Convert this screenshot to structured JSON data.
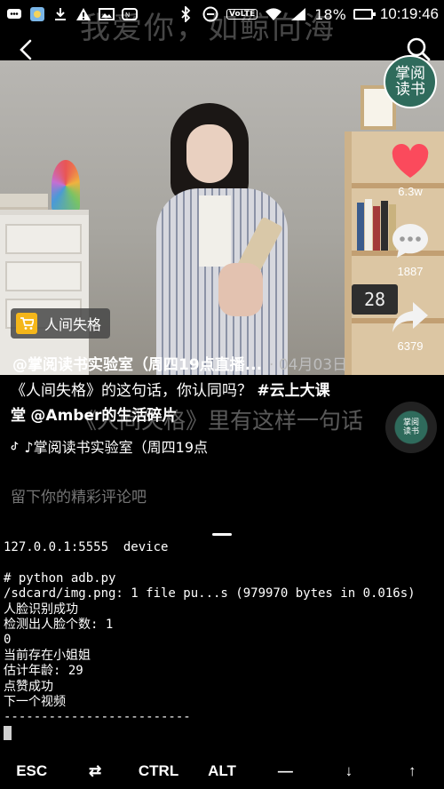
{
  "status_bar": {
    "battery": "18%",
    "time": "10:19:46",
    "volte": "VoLTE"
  },
  "lyric_top": "我爱你，如鲸向海",
  "video": {
    "calendar_text": "28"
  },
  "creator_badge": "掌阅读书",
  "actions": {
    "likes": "6.3w",
    "comments": "1887",
    "shares": "6379"
  },
  "tag_chip": "人间失格",
  "author": "@掌阅读书实验室（周四19点直播...",
  "date": "· 04月03日",
  "caption": {
    "text": "《人间失格》的这句话，你认同吗？",
    "hashtag": "#云上大课堂",
    "mention": "@Amber的生活碎片"
  },
  "lyric_mid": "《人间失格》里有这样一句话",
  "music": "♪掌阅读书实验室（周四19点",
  "music_disc": "掌阅读书",
  "comment_placeholder": "留下你的精彩评论吧",
  "terminal_lines": [
    "127.0.0.1:5555  device",
    "",
    "# python adb.py",
    "/sdcard/img.png: 1 file pu...s (979970 bytes in 0.016s)",
    "人脸识别成功",
    "检测出人脸个数: 1",
    "0",
    "当前存在小姐姐",
    "估计年龄: 29",
    "点赞成功",
    "下一个视频",
    "-------------------------"
  ],
  "extra_keys": [
    "ESC",
    "⇄",
    "CTRL",
    "ALT",
    "—",
    "↓",
    "↑"
  ]
}
